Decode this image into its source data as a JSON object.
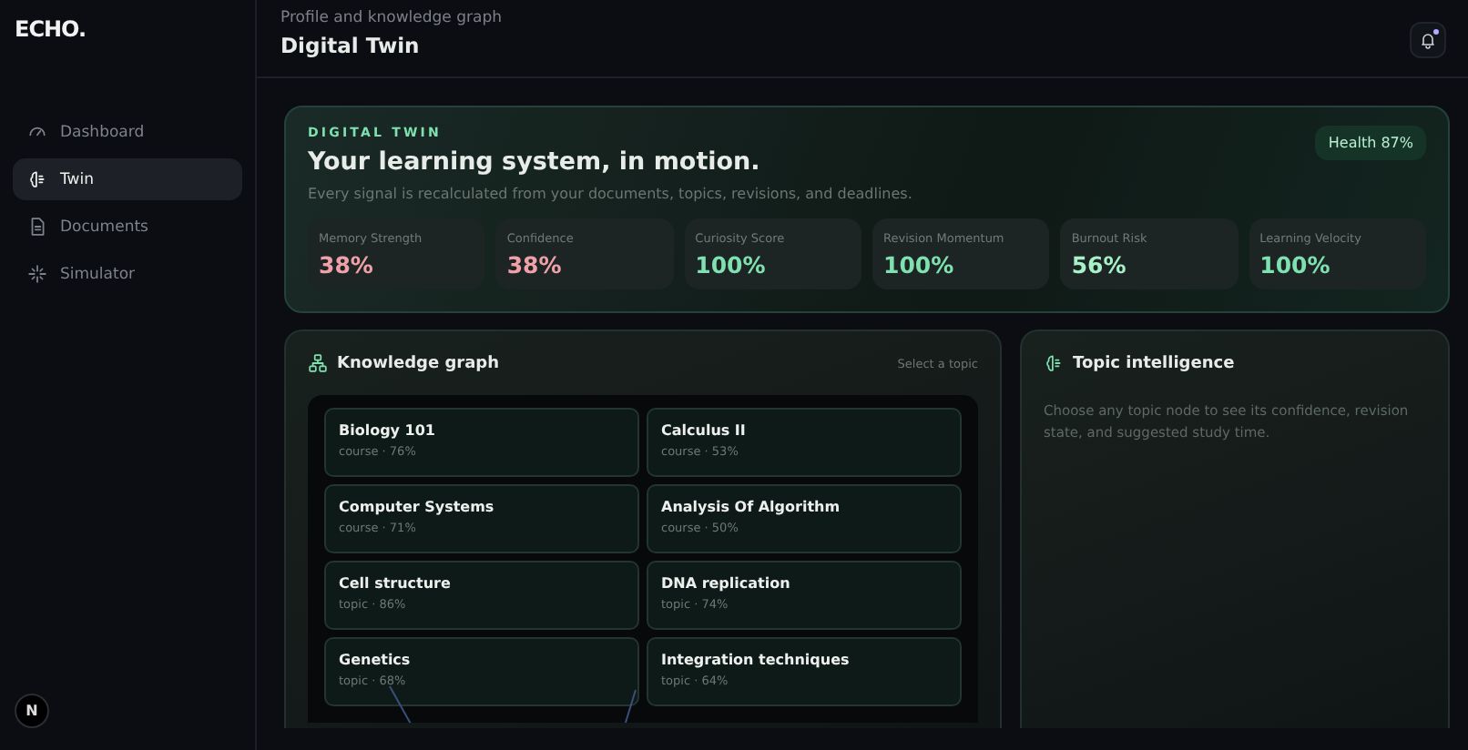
{
  "sidebar": {
    "logo": "ECHO.",
    "items": [
      {
        "label": "Dashboard",
        "selected": false
      },
      {
        "label": "Twin",
        "selected": true
      },
      {
        "label": "Documents",
        "selected": false
      },
      {
        "label": "Simulator",
        "selected": false
      }
    ],
    "avatar": "N"
  },
  "header": {
    "subtitle": "Profile and knowledge graph",
    "title": "Digital Twin",
    "notification": true
  },
  "hero": {
    "eyebrow": "DIGITAL TWIN",
    "title": "Your learning system, in motion.",
    "description": "Every signal is recalculated from your documents, topics, revisions, and deadlines.",
    "badge": "Health 87%",
    "metrics": [
      {
        "label": "Memory Strength",
        "value": "38%",
        "color": "#f0a0a8"
      },
      {
        "label": "Confidence",
        "value": "38%",
        "color": "#f0a0a8"
      },
      {
        "label": "Curiosity Score",
        "value": "100%",
        "color": "#7fe0b0"
      },
      {
        "label": "Revision Momentum",
        "value": "100%",
        "color": "#7fe0b0"
      },
      {
        "label": "Burnout Risk",
        "value": "56%",
        "color": "#a8f0c8"
      },
      {
        "label": "Learning Velocity",
        "value": "100%",
        "color": "#7fe0b0"
      }
    ]
  },
  "graph": {
    "title": "Knowledge graph",
    "hint": "Select a topic",
    "nodes": [
      {
        "name": "Biology 101",
        "meta": "course · 76%"
      },
      {
        "name": "Calculus II",
        "meta": "course · 53%"
      },
      {
        "name": "Computer Systems",
        "meta": "course · 71%"
      },
      {
        "name": "Analysis Of Algorithm",
        "meta": "course · 50%"
      },
      {
        "name": "Cell structure",
        "meta": "topic · 86%"
      },
      {
        "name": "DNA replication",
        "meta": "topic · 74%"
      },
      {
        "name": "Genetics",
        "meta": "topic · 68%"
      },
      {
        "name": "Integration techniques",
        "meta": "topic · 64%"
      }
    ]
  },
  "topic": {
    "title": "Topic intelligence",
    "description": "Choose any topic node to see its confidence, revision state, and suggested study time."
  }
}
